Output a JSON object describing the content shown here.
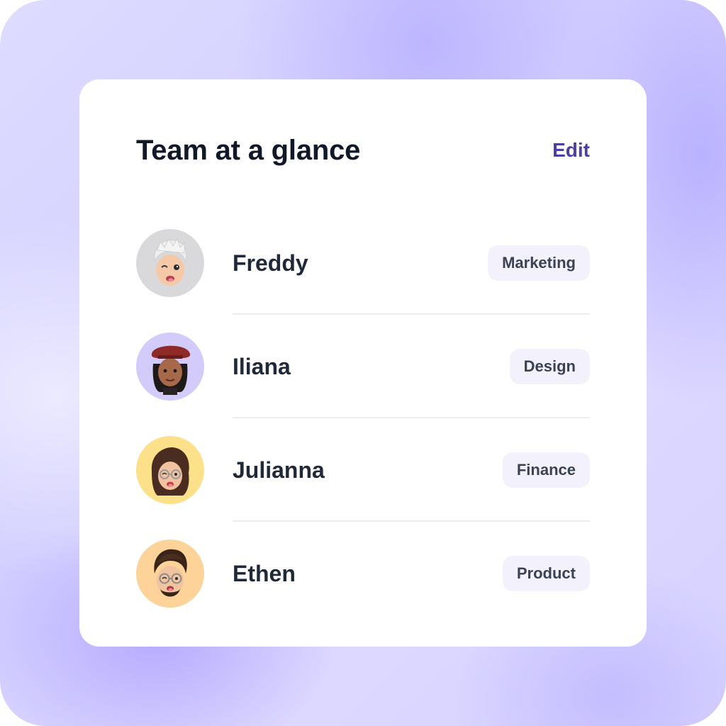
{
  "widget": {
    "title": "Team at a glance",
    "edit_label": "Edit"
  },
  "members": [
    {
      "name": "Freddy",
      "department": "Marketing",
      "avatar_icon": "avatar-freddy-icon",
      "avatar_bg": "#d9d9dc"
    },
    {
      "name": "Iliana",
      "department": "Design",
      "avatar_icon": "avatar-iliana-icon",
      "avatar_bg": "#d3ccfb"
    },
    {
      "name": "Julianna",
      "department": "Finance",
      "avatar_icon": "avatar-julianna-icon",
      "avatar_bg": "#fde08a"
    },
    {
      "name": "Ethen",
      "department": "Product",
      "avatar_icon": "avatar-ethen-icon",
      "avatar_bg": "#fdd39a"
    }
  ],
  "colors": {
    "accent": "#4b3fa3",
    "badge_bg": "#f3f2fc",
    "title_text": "#111827"
  }
}
